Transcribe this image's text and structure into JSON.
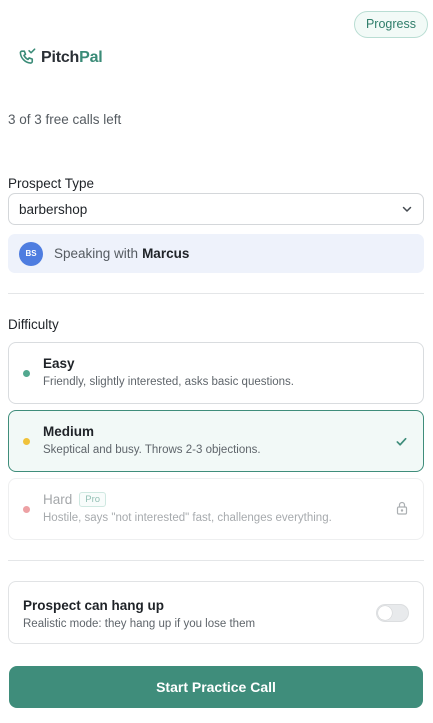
{
  "header": {
    "progress_label": "Progress",
    "logo_part1": "Pitch",
    "logo_part2": "Pal",
    "logo_icon": "phone-icon"
  },
  "free_calls": "3 of 3 free calls left",
  "prospect": {
    "label": "Prospect Type",
    "selected": "barbershop",
    "speaking_prefix": "Speaking with",
    "speaking_name": "Marcus",
    "avatar_initials": "BS"
  },
  "difficulty": {
    "label": "Difficulty",
    "options": [
      {
        "title": "Easy",
        "description": "Friendly, slightly interested, asks basic questions.",
        "dot_color": "#52a88f",
        "selected": false,
        "locked": false
      },
      {
        "title": "Medium",
        "description": "Skeptical and busy. Throws 2-3 objections.",
        "dot_color": "#f0c23a",
        "selected": true,
        "locked": false
      },
      {
        "title": "Hard",
        "badge": "Pro",
        "description": "Hostile, says \"not interested\" fast, challenges everything.",
        "dot_color": "#e0555b",
        "selected": false,
        "locked": true
      }
    ]
  },
  "hangup": {
    "title": "Prospect can hang up",
    "description": "Realistic mode: they hang up if you lose them",
    "enabled": false
  },
  "start_button": "Start Practice Call",
  "colors": {
    "accent": "#3f8d7b",
    "avatar": "#4e7de0"
  }
}
